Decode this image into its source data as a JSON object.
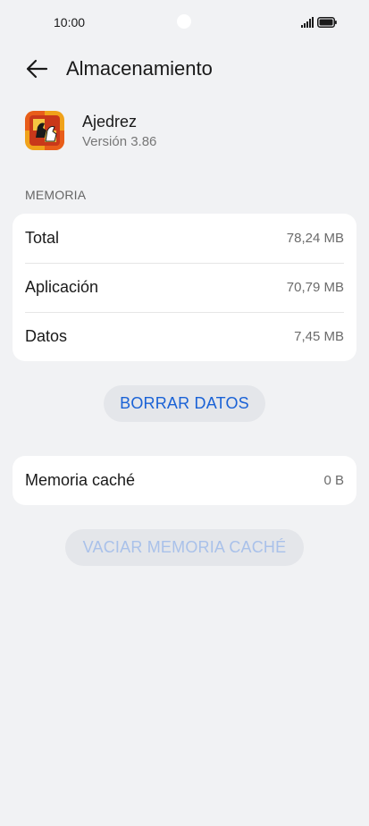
{
  "status_bar": {
    "time": "10:00"
  },
  "header": {
    "title": "Almacenamiento"
  },
  "app": {
    "name": "Ajedrez",
    "version": "Versión 3.86"
  },
  "memory": {
    "section_label": "MEMORIA",
    "rows": [
      {
        "label": "Total",
        "value": "78,24 MB"
      },
      {
        "label": "Aplicación",
        "value": "70,79 MB"
      },
      {
        "label": "Datos",
        "value": "7,45 MB"
      }
    ],
    "clear_data_label": "BORRAR DATOS"
  },
  "cache": {
    "label": "Memoria caché",
    "value": "0 B",
    "clear_cache_label": "VACIAR MEMORIA CACHÉ"
  },
  "colors": {
    "accent": "#1a62d6",
    "accent_disabled": "#a9c1ea",
    "background": "#f1f2f4",
    "card": "#ffffff"
  },
  "icons": {
    "back": "arrow-left-icon",
    "signal": "signal-icon",
    "battery": "battery-icon",
    "app": "chess-app-icon"
  }
}
